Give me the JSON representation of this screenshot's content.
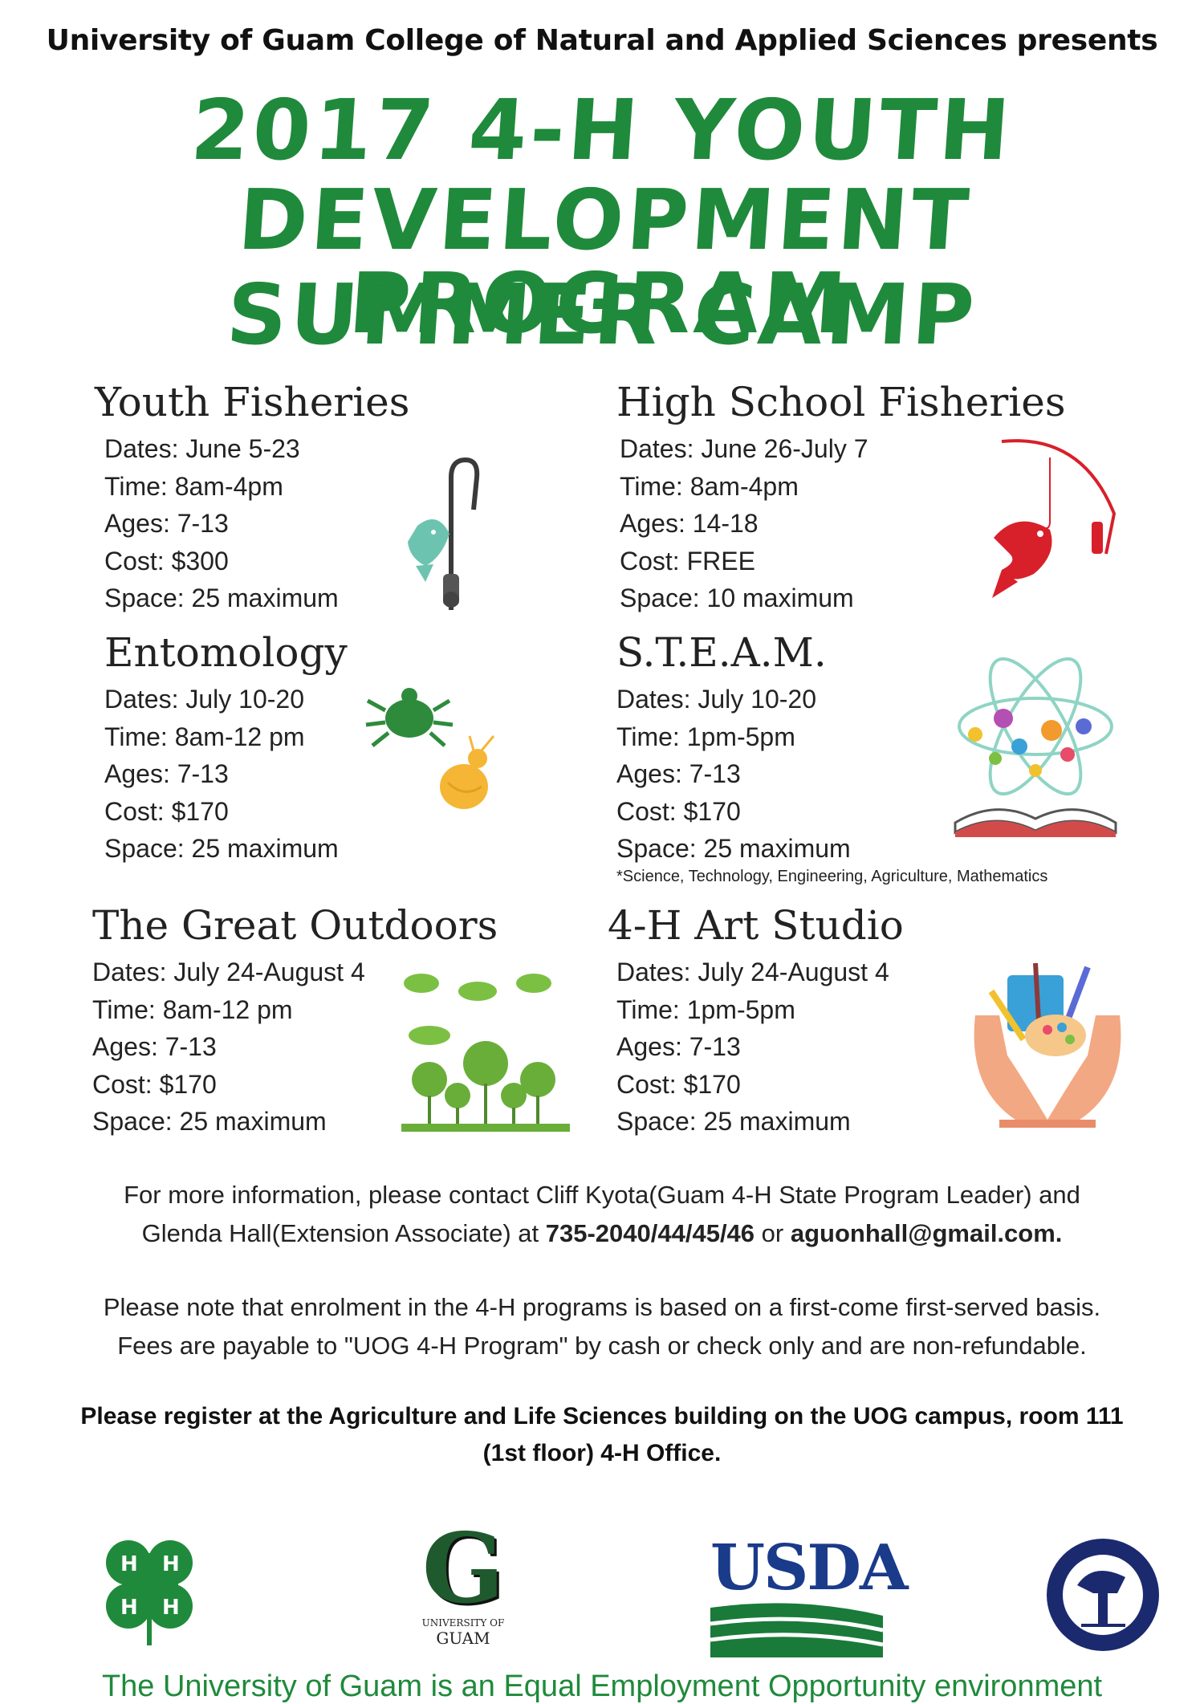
{
  "header": {
    "presenter": "University of Guam College of Natural and Applied Sciences presents",
    "title_line1": "2017 4-H YOUTH",
    "title_line2": "DEVELOPMENT PROGRAM",
    "title_line3": "SUMMER CAMP"
  },
  "camps": [
    {
      "name": "Youth Fisheries",
      "dates": "Dates: June 5-23",
      "time": "Time: 8am-4pm",
      "ages": "Ages: 7-13",
      "cost": "Cost: $300",
      "space": "Space: 25 maximum",
      "icon": "fishing-rod-icon"
    },
    {
      "name": "High School Fisheries",
      "dates": "Dates: June 26-July 7",
      "time": "Time: 8am-4pm",
      "ages": "Ages: 14-18",
      "cost": "Cost: FREE",
      "space": "Space: 10 maximum",
      "icon": "fish-on-hook-icon"
    },
    {
      "name": "Entomology",
      "dates": "Dates: July 10-20",
      "time": "Time: 8am-12 pm",
      "ages": "Ages: 7-13",
      "cost": "Cost: $170",
      "space": "Space: 25 maximum",
      "icon": "insects-icon"
    },
    {
      "name": "S.T.E.A.M.",
      "dates": "Dates: July 10-20",
      "time": "Time: 1pm-5pm",
      "ages": "Ages: 7-13",
      "cost": "Cost: $170",
      "space": "Space: 25 maximum",
      "note": "*Science, Technology, Engineering, Agriculture, Mathematics",
      "icon": "atom-book-icon"
    },
    {
      "name": "The Great Outdoors",
      "dates": "Dates: July 24-August 4",
      "time": "Time: 8am-12 pm",
      "ages": "Ages: 7-13",
      "cost": "Cost: $170",
      "space": "Space: 25 maximum",
      "icon": "trees-icon"
    },
    {
      "name": "4-H Art Studio",
      "dates": "Dates: July 24-August 4",
      "time": "Time: 1pm-5pm",
      "ages": "Ages: 7-13",
      "cost": "Cost: $170",
      "space": "Space: 25 maximum",
      "icon": "art-supplies-hands-icon"
    }
  ],
  "contact": {
    "line1": "For more information, please contact Cliff Kyota(Guam 4-H State Program Leader) and",
    "line2_prefix": "Glenda Hall(Extension Associate) at ",
    "phone": "735-2040/44/45/46",
    "line2_mid": " or ",
    "email": "aguonhall@gmail.com."
  },
  "notice": {
    "line1": "Please note that enrolment in the 4-H programs is based on a first-come first-served basis.",
    "line2": "Fees are payable to \"UOG 4-H Program\" by cash or check only and are non-refundable."
  },
  "register": {
    "line1": "Please register at the Agriculture and Life Sciences building on the UOG campus, room 111",
    "line2": "(1st floor) 4-H Office."
  },
  "logos": {
    "uog_line1": "UNIVERSITY OF",
    "uog_line2": "GUAM",
    "usda": "USDA",
    "gpss": "GUAM PUBLIC SCHOOL SYSTEM"
  },
  "footer": "The University of Guam is an Equal Employment Opportunity environment",
  "colors": {
    "title_green": "#1f8a3b",
    "usda_blue": "#1a3a8a",
    "gpss_navy": "#1b2a6e"
  }
}
